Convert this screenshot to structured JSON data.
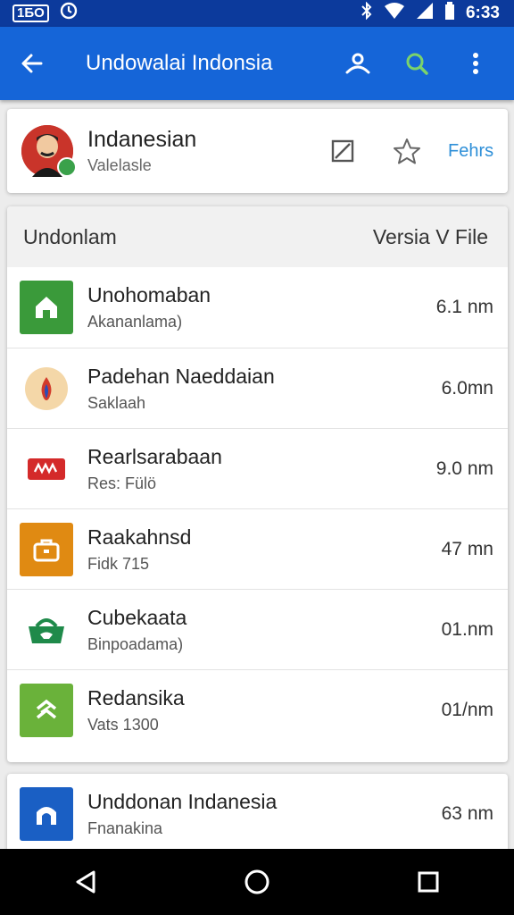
{
  "status_bar": {
    "badge": "1БО",
    "time": "6:33",
    "icons": [
      "alarm-icon",
      "bluetooth-icon",
      "wifi-icon",
      "signal-icon",
      "battery-icon"
    ]
  },
  "app_bar": {
    "title": "Undowalai Indonsia",
    "icons": [
      "back-arrow-icon",
      "person-icon",
      "search-icon",
      "more-vert-icon"
    ],
    "accent": "#1565d8"
  },
  "header": {
    "name": "Indanesian",
    "subtitle": "Valelasle",
    "action_label": "Fehrs"
  },
  "list": {
    "left_heading": "Undonlam",
    "right_heading": "Versia V File",
    "items": [
      {
        "name": "Unohomaban",
        "sub": "Akananlama)",
        "size": "6.1 nm",
        "icon": "home-icon",
        "color": "#3a9a3a"
      },
      {
        "name": "Padehan Naeddaian",
        "sub": "Saklaah",
        "size": "6.0mn",
        "icon": "flame-icon",
        "color": "#f4d7a8"
      },
      {
        "name": "Rearlsarabaan",
        "sub": "Res: Fülö",
        "size": "9.0 nm",
        "icon": "ticket-icon",
        "color": "#d42a2a"
      },
      {
        "name": "Raakahnsd",
        "sub": "Fidk 715",
        "size": "47 mn",
        "icon": "briefcase-icon",
        "color": "#e08a12"
      },
      {
        "name": "Cubekaata",
        "sub": "Binpoadama)",
        "size": "01.nm",
        "icon": "basket-icon",
        "color": "#1f8a4a"
      },
      {
        "name": "Redansika",
        "sub": "Vats 1300",
        "size": "01/nm",
        "icon": "chevrons-icon",
        "color": "#6ab23a"
      }
    ]
  },
  "bottom_item": {
    "name": "Unddonan Indanesia",
    "sub": "Fnanakina",
    "size": "63 nm",
    "icon": "arch-icon"
  },
  "nav_bar": {
    "icons": [
      "back-triangle-icon",
      "home-circle-icon",
      "recents-square-icon"
    ]
  }
}
